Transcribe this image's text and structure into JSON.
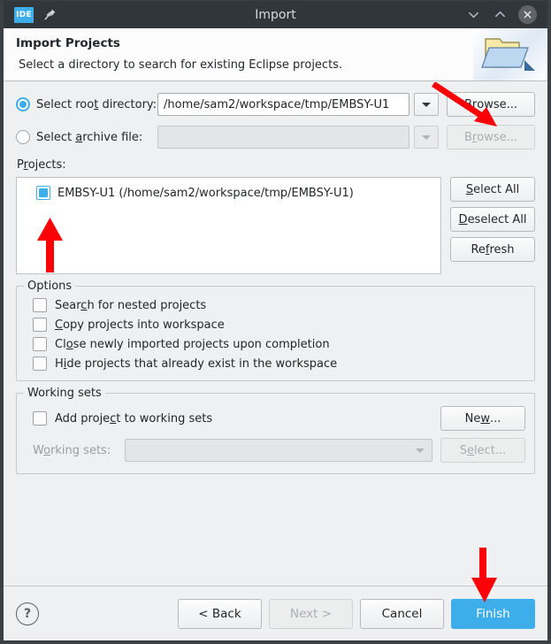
{
  "window": {
    "app_icon_text": "IDE",
    "title": "Import",
    "pin_icon": "pin-icon",
    "minimize_icon": "chevron-down-icon",
    "maximize_icon": "chevron-up-icon",
    "close_icon": "close-icon"
  },
  "banner": {
    "title": "Import Projects",
    "subtitle": "Select a directory to search for existing Eclipse projects.",
    "icon": "folder-import-icon"
  },
  "source": {
    "root_directory": {
      "label_pre": "Select roo",
      "label_mnemonic": "t",
      "label_post": " directory:",
      "selected": true,
      "value": "/home/sam2/workspace/tmp/EMBSY-U1",
      "dropdown_icon": "chevron-down-icon",
      "browse_pre": "B",
      "browse_mnemonic": "r",
      "browse_post": "owse...",
      "browse_enabled": true
    },
    "archive_file": {
      "label_pre": "Select ",
      "label_mnemonic": "a",
      "label_post": "rchive file:",
      "selected": false,
      "value": "",
      "dropdown_icon": "chevron-down-icon",
      "browse_pre": "B",
      "browse_mnemonic": "r",
      "browse_post": "owse...",
      "browse_enabled": false
    }
  },
  "projects": {
    "label_pre": "P",
    "label_mnemonic": "r",
    "label_post": "ojects:",
    "items": [
      {
        "label": "EMBSY-U1 (/home/sam2/workspace/tmp/EMBSY-U1)",
        "checked": true
      }
    ],
    "buttons": [
      {
        "pre": "",
        "mnemonic": "S",
        "post": "elect All",
        "enabled": true
      },
      {
        "pre": "",
        "mnemonic": "D",
        "post": "eselect All",
        "enabled": true
      },
      {
        "pre": "Re",
        "mnemonic": "f",
        "post": "resh",
        "enabled": true
      }
    ]
  },
  "options": {
    "title": "Options",
    "items": [
      {
        "pre": "Sear",
        "mnemonic": "c",
        "post": "h for nested projects",
        "checked": false
      },
      {
        "pre": "",
        "mnemonic": "C",
        "post": "opy projects into workspace",
        "checked": false
      },
      {
        "pre": "Cl",
        "mnemonic": "o",
        "post": "se newly imported projects upon completion",
        "checked": false
      },
      {
        "pre": "H",
        "mnemonic": "i",
        "post": "de projects that already exist in the workspace",
        "checked": false
      }
    ]
  },
  "working_sets": {
    "title": "Working sets",
    "add_checkbox": {
      "pre": "Add proje",
      "mnemonic": "c",
      "post": "t to working sets",
      "checked": false
    },
    "new_button": {
      "pre": "Ne",
      "mnemonic": "w",
      "post": "...",
      "enabled": true
    },
    "combo_label_pre": "W",
    "combo_label_mnemonic": "o",
    "combo_label_post": "rking sets:",
    "combo_value": "",
    "combo_enabled": false,
    "combo_icon": "chevron-down-icon",
    "select_button": {
      "pre": "S",
      "mnemonic": "e",
      "post": "lect...",
      "enabled": false
    }
  },
  "footer": {
    "help_icon": "help-icon",
    "back": {
      "label": "< Back",
      "enabled": true
    },
    "next": {
      "label": "Next >",
      "enabled": false
    },
    "cancel": {
      "label": "Cancel",
      "enabled": true
    },
    "finish": {
      "label": "Finish",
      "enabled": true,
      "primary": true
    }
  },
  "annotations": {
    "color": "#fb0007",
    "arrows": [
      {
        "name": "arrow-to-browse-button",
        "direction": "down-right"
      },
      {
        "name": "arrow-to-project-checkbox",
        "direction": "up"
      },
      {
        "name": "arrow-to-finish-button",
        "direction": "down"
      }
    ]
  }
}
